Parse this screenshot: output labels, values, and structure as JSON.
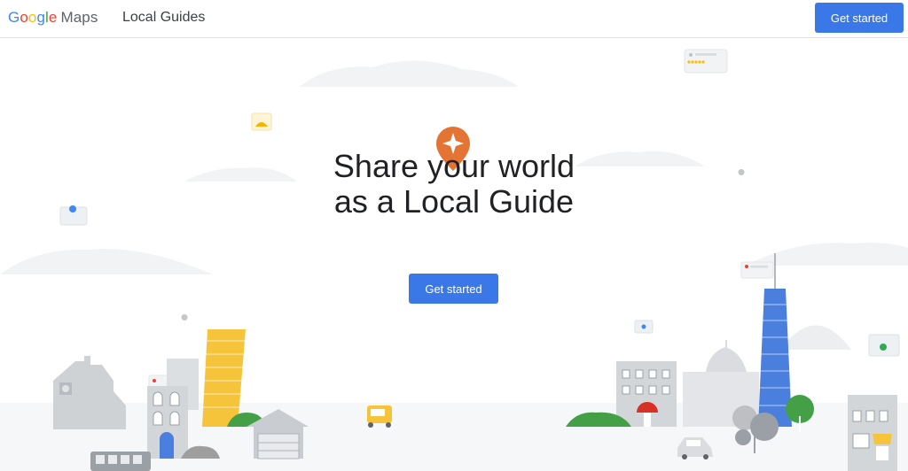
{
  "header": {
    "logo_letters": [
      "G",
      "o",
      "o",
      "g",
      "l",
      "e"
    ],
    "logo_product": "Maps",
    "section_title": "Local Guides",
    "cta_label": "Get started"
  },
  "hero": {
    "headline_line1": "Share your world",
    "headline_line2": "as a Local Guide",
    "cta_label": "Get started"
  },
  "colors": {
    "primary_button": "#3b78e7",
    "badge_orange": "#e37434",
    "tower_blue": "#4a7fde",
    "building_yellow": "#f5c43a",
    "tree_green": "#4caf50"
  },
  "icons": [
    "local-guides-badge-icon",
    "map-pin-icon",
    "review-card-icon",
    "star-rating-icon"
  ]
}
